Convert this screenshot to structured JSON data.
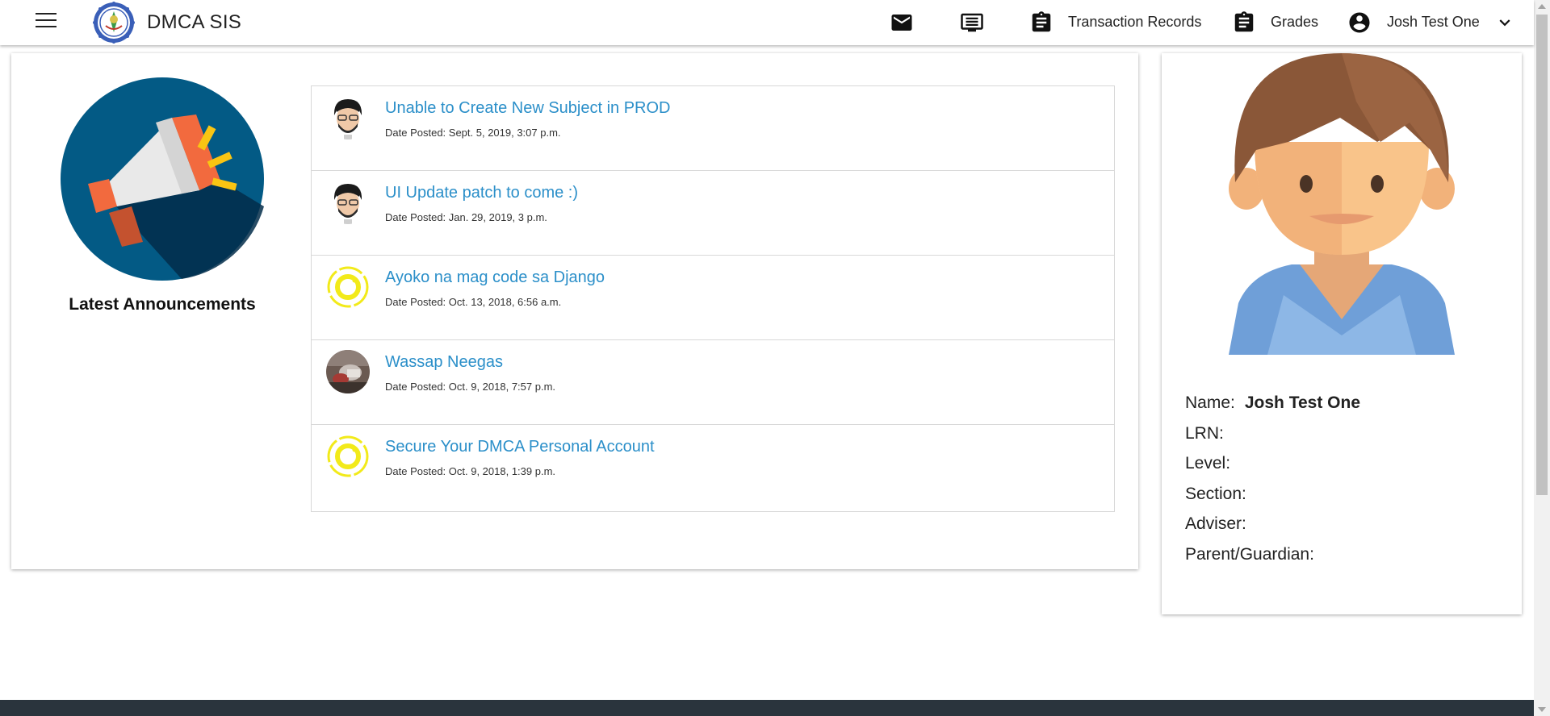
{
  "header": {
    "brand": "DMCA SIS",
    "nav": {
      "transactions_label": "Transaction Records",
      "grades_label": "Grades",
      "user_name": "Josh Test One"
    }
  },
  "announcements": {
    "heading": "Latest Announcements",
    "items": [
      {
        "title": "Unable to Create New Subject in PROD",
        "date": "Date Posted: Sept. 5, 2019, 3:07 p.m.",
        "avatar": "cartoon-man-avatar"
      },
      {
        "title": "UI Update patch to come :)",
        "date": "Date Posted: Jan. 29, 2019, 3 p.m.",
        "avatar": "cartoon-man-avatar"
      },
      {
        "title": "Ayoko na mag code sa Django",
        "date": "Date Posted: Oct. 13, 2018, 6:56 a.m.",
        "avatar": "yellow-ring-avatar"
      },
      {
        "title": "Wassap Neegas",
        "date": "Date Posted: Oct. 9, 2018, 7:57 p.m.",
        "avatar": "photo-avatar"
      },
      {
        "title": "Secure Your DMCA Personal Account",
        "date": "Date Posted: Oct. 9, 2018, 1:39 p.m.",
        "avatar": "yellow-ring-avatar"
      }
    ]
  },
  "profile": {
    "fields": [
      {
        "label": "Name:",
        "value": "Josh Test One"
      },
      {
        "label": "LRN:",
        "value": ""
      },
      {
        "label": "Level:",
        "value": ""
      },
      {
        "label": "Section:",
        "value": ""
      },
      {
        "label": "Adviser:",
        "value": ""
      },
      {
        "label": "Parent/Guardian:",
        "value": ""
      }
    ]
  },
  "colors": {
    "link": "#2b8fc9",
    "footer": "#2a343d",
    "megaphone_bg": "#035a85"
  }
}
